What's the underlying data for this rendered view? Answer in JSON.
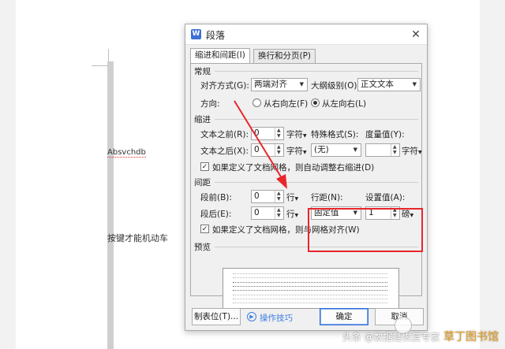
{
  "document": {
    "text_line1": "Absvchdb",
    "text_line2": "按键才能机动车"
  },
  "dialog": {
    "title": "段落",
    "close_glyph": "✕",
    "tabs": [
      {
        "label": "缩进和间距(I)",
        "active": true
      },
      {
        "label": "换行和分页(P)",
        "active": false
      }
    ],
    "general": {
      "section": "常规",
      "alignment_label": "对齐方式(G):",
      "alignment_value": "两端对齐",
      "outline_label": "大纲级别(O):",
      "outline_value": "正文文本",
      "direction_label": "方向:",
      "rtl_label": "从右向左(F)",
      "ltr_label": "从左向右(L)",
      "direction_selected": "ltr"
    },
    "indent": {
      "section": "缩进",
      "before_label": "文本之前(R):",
      "before_value": "0",
      "after_label": "文本之后(X):",
      "after_value": "0",
      "unit": "字符",
      "special_label": "特殊格式(S):",
      "special_value": "(无)",
      "measure_label": "度量值(Y):",
      "measure_value": "",
      "measure_unit": "字符",
      "auto_adjust_label": "如果定义了文档网格，则自动调整右缩进(D)",
      "auto_adjust_checked": true
    },
    "spacing": {
      "section": "间距",
      "before_label": "段前(B):",
      "before_value": "0",
      "after_label": "段后(E):",
      "after_value": "0",
      "unit": "行",
      "line_spacing_label": "行距(N):",
      "line_spacing_value": "固定值",
      "set_value_label": "设置值(A):",
      "set_value": "1",
      "set_value_unit": "磅",
      "snap_grid_label": "如果定义了文档网格，则与网格对齐(W)",
      "snap_grid_checked": true
    },
    "preview": {
      "section": "预览"
    },
    "footer": {
      "tabs_button": "制表位(T)...",
      "tips_label": "操作技巧",
      "ok_button": "确定",
      "cancel_button": "取消"
    }
  },
  "watermark": {
    "brand": "草丁图书馆",
    "source": "头条 @数据蛙恢复专家"
  },
  "colors": {
    "highlight": "#e8262b",
    "accent_blue": "#3f7fe0",
    "brand_orange": "#e8a11c"
  }
}
